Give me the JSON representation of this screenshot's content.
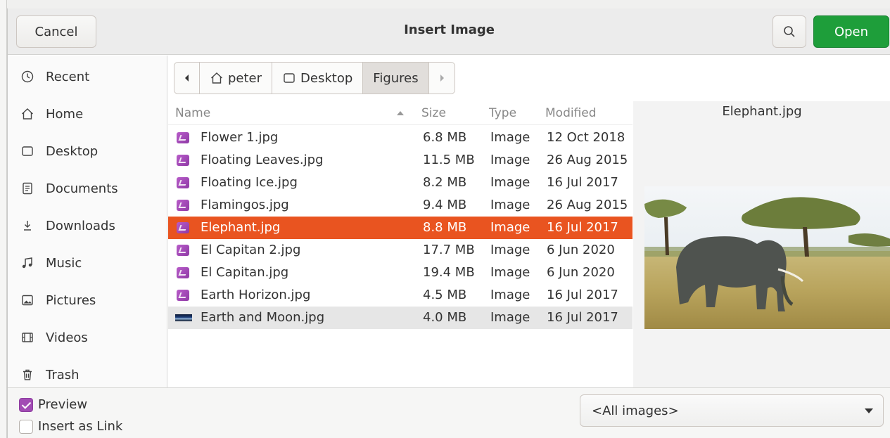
{
  "header": {
    "cancel_label": "Cancel",
    "title": "Insert Image",
    "open_label": "Open"
  },
  "sidebar": {
    "items": [
      {
        "label": "Recent",
        "icon": "clock-icon"
      },
      {
        "label": "Home",
        "icon": "home-icon"
      },
      {
        "label": "Desktop",
        "icon": "desktop-icon"
      },
      {
        "label": "Documents",
        "icon": "document-icon"
      },
      {
        "label": "Downloads",
        "icon": "download-icon"
      },
      {
        "label": "Music",
        "icon": "music-icon"
      },
      {
        "label": "Pictures",
        "icon": "picture-icon"
      },
      {
        "label": "Videos",
        "icon": "video-icon"
      },
      {
        "label": "Trash",
        "icon": "trash-icon"
      }
    ]
  },
  "pathbar": {
    "segments": [
      "peter",
      "Desktop",
      "Figures"
    ],
    "active": "Figures"
  },
  "file_list": {
    "columns": {
      "name": "Name",
      "size": "Size",
      "type": "Type",
      "modified": "Modified"
    },
    "rows": [
      {
        "name": "Flower 1.jpg",
        "size": "6.8 MB",
        "type": "Image",
        "modified": "12 Oct 2018"
      },
      {
        "name": "Floating Leaves.jpg",
        "size": "11.5 MB",
        "type": "Image",
        "modified": "26 Aug 2015"
      },
      {
        "name": "Floating Ice.jpg",
        "size": "8.2 MB",
        "type": "Image",
        "modified": "16 Jul 2017"
      },
      {
        "name": "Flamingos.jpg",
        "size": "9.4 MB",
        "type": "Image",
        "modified": "26 Aug 2015"
      },
      {
        "name": "Elephant.jpg",
        "size": "8.8 MB",
        "type": "Image",
        "modified": "16 Jul 2017"
      },
      {
        "name": "El Capitan 2.jpg",
        "size": "17.7 MB",
        "type": "Image",
        "modified": "6 Jun 2020"
      },
      {
        "name": "El Capitan.jpg",
        "size": "19.4 MB",
        "type": "Image",
        "modified": "6 Jun 2020"
      },
      {
        "name": "Earth Horizon.jpg",
        "size": "4.5 MB",
        "type": "Image",
        "modified": "16 Jul 2017"
      },
      {
        "name": "Earth and Moon.jpg",
        "size": "4.0 MB",
        "type": "Image",
        "modified": "16 Jul 2017"
      }
    ],
    "selected": "Elephant.jpg"
  },
  "preview": {
    "filename": "Elephant.jpg"
  },
  "footer": {
    "preview_label": "Preview",
    "preview_checked": true,
    "insert_link_label": "Insert as Link",
    "insert_link_checked": false,
    "filter_value": "<All images>"
  },
  "colors": {
    "accent_selected": "#e95420",
    "open_button": "#1e9e3a",
    "checkbox_on": "#a24cb4"
  }
}
